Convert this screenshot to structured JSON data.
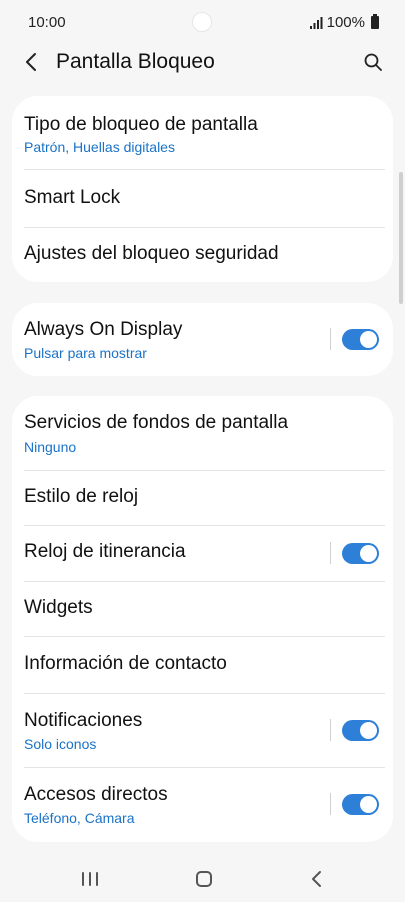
{
  "status": {
    "time": "10:00",
    "battery": "100%"
  },
  "header": {
    "title": "Pantalla Bloqueo"
  },
  "card1": [
    {
      "title": "Tipo de bloqueo de pantalla",
      "sub": "Patrón, Huellas digitales"
    },
    {
      "title": "Smart Lock"
    },
    {
      "title": "Ajustes del bloqueo seguridad"
    }
  ],
  "card2": [
    {
      "title": "Always On Display",
      "sub": "Pulsar para mostrar",
      "toggle": true
    }
  ],
  "card3": [
    {
      "title": "Servicios de fondos de pantalla",
      "sub": "Ninguno"
    },
    {
      "title": "Estilo de reloj"
    },
    {
      "title": "Reloj de itinerancia",
      "toggle": true
    },
    {
      "title": "Widgets"
    },
    {
      "title": "Información de contacto"
    },
    {
      "title": "Notificaciones",
      "sub": "Solo iconos",
      "toggle": true
    },
    {
      "title": "Accesos directos",
      "sub": "Teléfono, Cámara",
      "toggle": true
    }
  ],
  "colors": {
    "accent": "#2d7fd8",
    "subtext": "#1a73c8",
    "background": "#f6f6f6"
  }
}
